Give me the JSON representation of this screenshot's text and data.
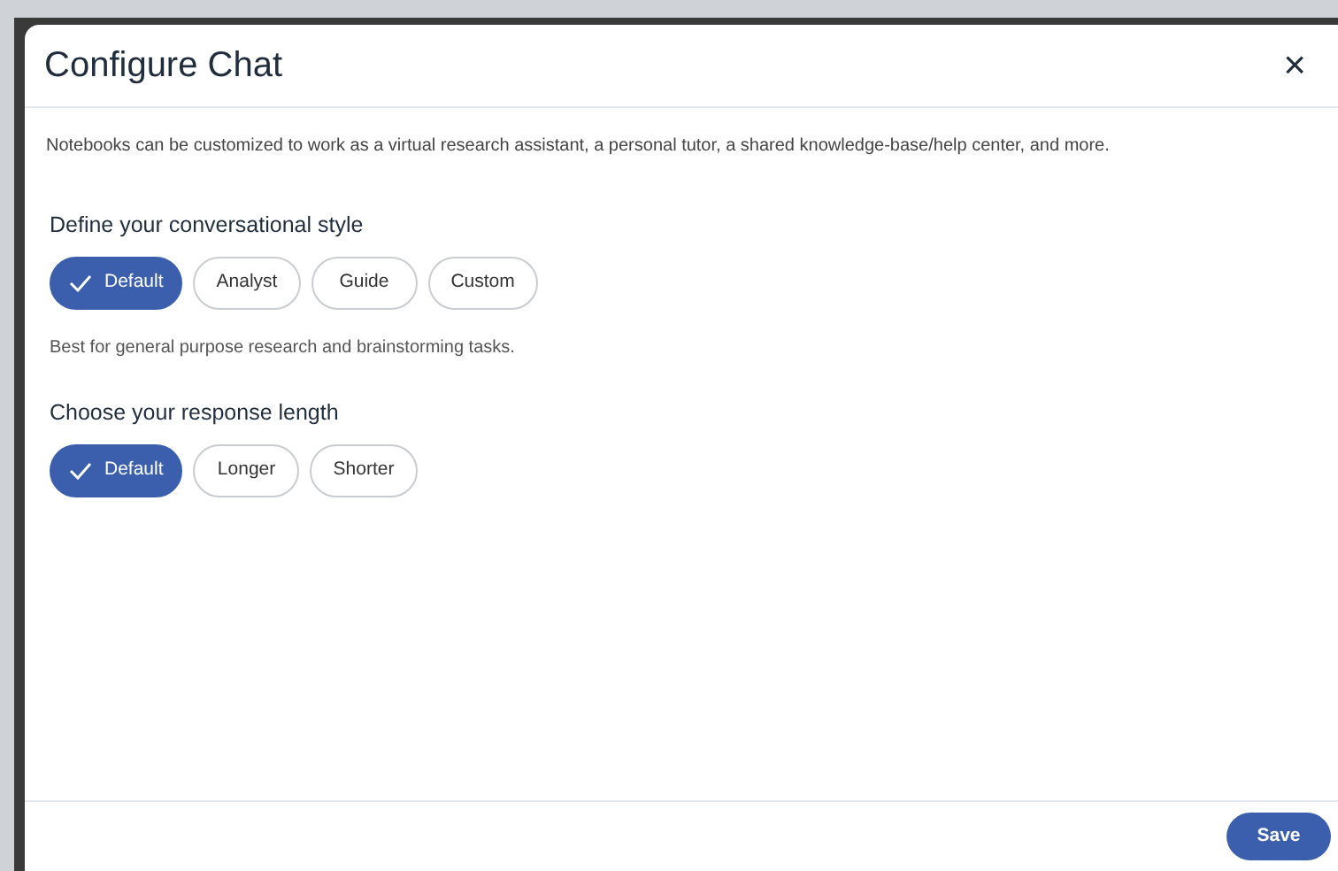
{
  "dialog": {
    "title": "Configure Chat",
    "close": "×",
    "description": "Notebooks can be customized to work as a virtual research assistant, a personal tutor, a shared knowledge-base/help center, and more.",
    "sections": [
      {
        "heading": "Define your conversational style",
        "options": [
          {
            "label": "Default",
            "selected": true
          },
          {
            "label": "Analyst",
            "selected": false
          },
          {
            "label": "Guide",
            "selected": false
          },
          {
            "label": "Custom",
            "selected": false
          }
        ],
        "hint": "Best for general purpose research and brainstorming tasks."
      },
      {
        "heading": "Choose your response length",
        "options": [
          {
            "label": "Default",
            "selected": true
          },
          {
            "label": "Longer",
            "selected": false
          },
          {
            "label": "Shorter",
            "selected": false
          }
        ]
      }
    ],
    "save": "Save"
  }
}
